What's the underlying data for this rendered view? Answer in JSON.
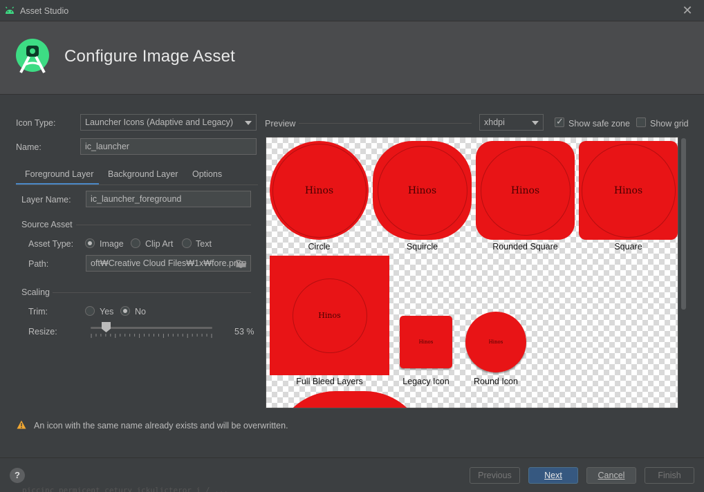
{
  "window": {
    "title": "Asset Studio",
    "close_icon": "close-icon"
  },
  "header": {
    "title": "Configure Image Asset"
  },
  "form": {
    "icon_type_label": "Icon Type:",
    "icon_type_value": "Launcher Icons (Adaptive and Legacy)",
    "name_label": "Name:",
    "name_value": "ic_launcher"
  },
  "tabs": [
    {
      "label": "Foreground Layer",
      "active": true
    },
    {
      "label": "Background Layer",
      "active": false
    },
    {
      "label": "Options",
      "active": false
    }
  ],
  "foreground": {
    "layer_name_label": "Layer Name:",
    "layer_name_value": "ic_launcher_foreground",
    "source_asset_label": "Source Asset",
    "asset_type_label": "Asset Type:",
    "asset_types": [
      {
        "label": "Image",
        "selected": true
      },
      {
        "label": "Clip Art",
        "selected": false
      },
      {
        "label": "Text",
        "selected": false
      }
    ],
    "path_label": "Path:",
    "path_value": "oft₩Creative Cloud Files₩1x₩fore.png",
    "scaling_label": "Scaling",
    "trim_label": "Trim:",
    "trim_options": [
      {
        "label": "Yes",
        "selected": false
      },
      {
        "label": "No",
        "selected": true
      }
    ],
    "resize_label": "Resize:",
    "resize_value": 53,
    "resize_text": "53 %"
  },
  "preview": {
    "label": "Preview",
    "density": "xhdpi",
    "show_safe_zone_label": "Show safe zone",
    "show_safe_zone": true,
    "show_grid_label": "Show grid",
    "show_grid": false,
    "icon_color": "#e81416",
    "icon_text": "Hinos",
    "items": [
      {
        "caption": "Circle"
      },
      {
        "caption": "Squircle"
      },
      {
        "caption": "Rounded Square"
      },
      {
        "caption": "Square"
      },
      {
        "caption": "Full Bleed Layers"
      },
      {
        "caption": "Legacy Icon"
      },
      {
        "caption": "Round Icon"
      }
    ]
  },
  "warning": {
    "text": "An icon with the same name already exists and will be overwritten."
  },
  "footer": {
    "help": "?",
    "previous": "Previous",
    "next": "Next",
    "cancel": "Cancel",
    "finish": "Finish",
    "background_text": "piccinc permicent cetury ickulicteror i / ... "
  },
  "colors": {
    "accent": "#4a88c7",
    "primary_button": "#365880",
    "warning": "#f0a732"
  }
}
